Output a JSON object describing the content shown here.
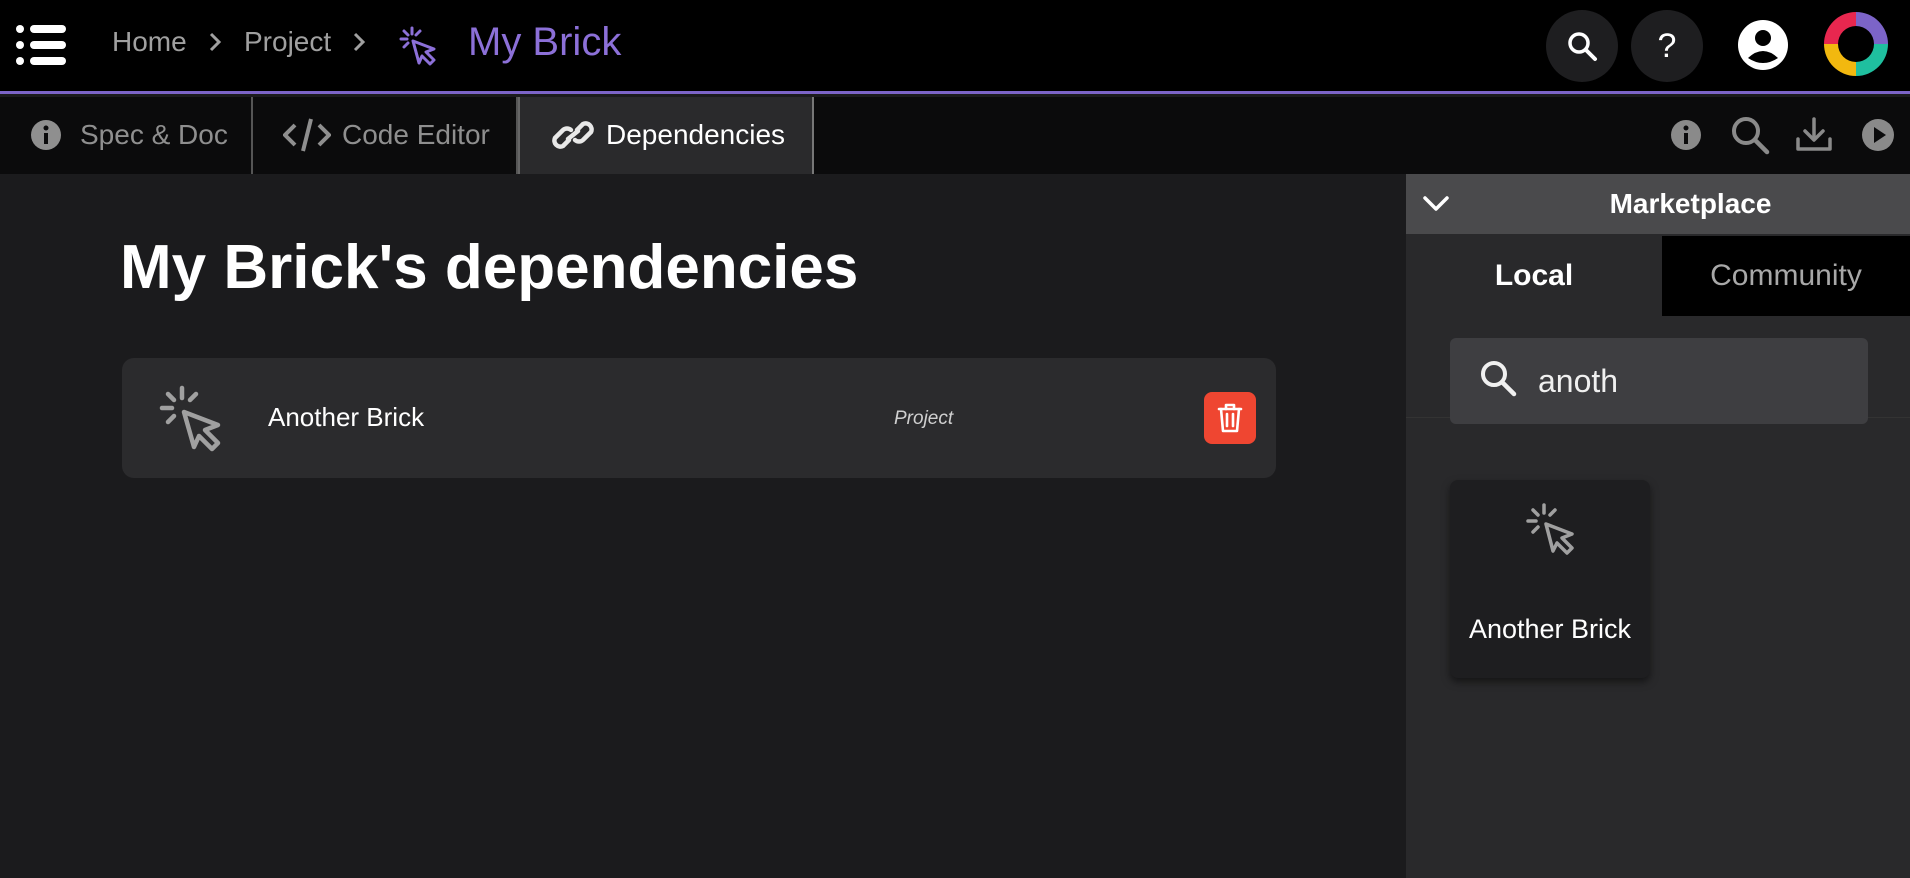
{
  "header": {
    "breadcrumbs": [
      "Home",
      "Project"
    ],
    "current_brick": "My Brick",
    "help_label": "?"
  },
  "tabs": {
    "spec": "Spec & Doc",
    "code": "Code Editor",
    "deps": "Dependencies",
    "active": "Dependencies"
  },
  "main": {
    "title": "My Brick's dependencies",
    "dependencies": [
      {
        "name": "Another Brick",
        "source": "Project"
      }
    ]
  },
  "marketplace": {
    "title": "Marketplace",
    "tabs": [
      "Local",
      "Community"
    ],
    "active_tab": "Local",
    "search_value": "anoth",
    "results": [
      {
        "name": "Another Brick"
      }
    ]
  },
  "colors": {
    "accent": "#7c64c8",
    "brand_text": "#8c70d8",
    "delete": "#ef4631"
  },
  "icons": [
    "menu-icon",
    "chevron-right-icon",
    "brick-cursor-icon",
    "search-icon",
    "help-icon",
    "user-icon",
    "app-logo",
    "info-icon",
    "code-icon",
    "link-icon",
    "download-icon",
    "play-icon",
    "trash-icon",
    "chevron-down-icon"
  ]
}
